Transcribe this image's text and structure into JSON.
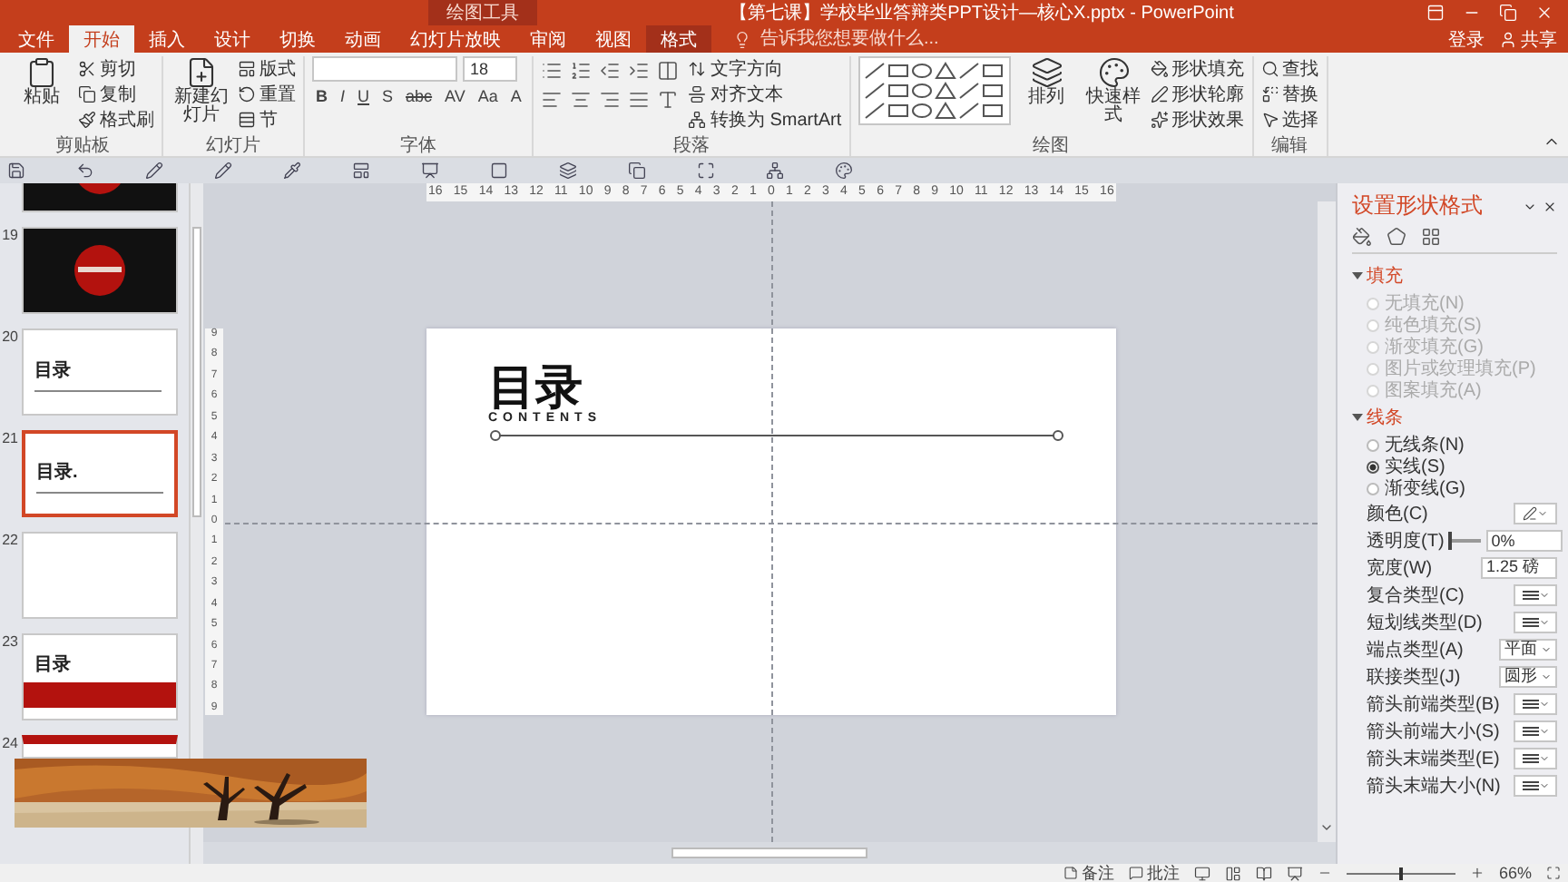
{
  "title_bar": {
    "context_group": "绘图工具",
    "title": "【第七课】学校毕业答辩类PPT设计—核心X.pptx - PowerPoint"
  },
  "tabs": [
    {
      "label": "文件",
      "selected": false,
      "contextual": false
    },
    {
      "label": "开始",
      "selected": true,
      "contextual": false
    },
    {
      "label": "插入",
      "selected": false,
      "contextual": false
    },
    {
      "label": "设计",
      "selected": false,
      "contextual": false
    },
    {
      "label": "切换",
      "selected": false,
      "contextual": false
    },
    {
      "label": "动画",
      "selected": false,
      "contextual": false
    },
    {
      "label": "幻灯片放映",
      "selected": false,
      "contextual": false
    },
    {
      "label": "审阅",
      "selected": false,
      "contextual": false
    },
    {
      "label": "视图",
      "selected": false,
      "contextual": false
    },
    {
      "label": "格式",
      "selected": false,
      "contextual": true
    }
  ],
  "tell_me": {
    "placeholder": "告诉我您想要做什么..."
  },
  "account": {
    "sign_in": "登录",
    "share": "共享"
  },
  "ribbon_groups": [
    {
      "kind": "clipboard",
      "label": "剪贴板",
      "large_buttons": [
        "粘贴"
      ],
      "small_buttons": [
        "剪切",
        "复制",
        "格式刷"
      ]
    },
    {
      "kind": "slides",
      "label": "幻灯片",
      "large_buttons": [
        "新建幻灯片"
      ],
      "small_buttons": [
        "版式",
        "重置",
        "节"
      ]
    },
    {
      "kind": "font",
      "label": "字体",
      "font_size": "18",
      "format_buttons": [
        "B",
        "I",
        "U",
        "S",
        "abc",
        "AV",
        "Aa",
        "A"
      ]
    },
    {
      "kind": "paragraph",
      "label": "段落",
      "small_buttons": [
        "文字方向",
        "对齐文本",
        "转换为 SmartArt"
      ]
    },
    {
      "kind": "drawing",
      "label": "绘图",
      "large_buttons": [
        "排列",
        "快速样式"
      ],
      "small_buttons": [
        "形状填充",
        "形状轮廓",
        "形状效果"
      ]
    },
    {
      "kind": "editing",
      "label": "编辑",
      "small_buttons": [
        "查找",
        "替换",
        "选择"
      ]
    }
  ],
  "thumbnails": [
    {
      "kind": "dark",
      "selected": false
    },
    {
      "number": "19",
      "kind": "dark",
      "selected": false
    },
    {
      "number": "20",
      "kind": "contents",
      "title": "目录",
      "selected": false
    },
    {
      "number": "21",
      "kind": "contents",
      "title": "目录.",
      "selected": true
    },
    {
      "number": "22",
      "kind": "blank",
      "selected": false
    },
    {
      "number": "23",
      "kind": "red_band",
      "title": "目录",
      "selected": false
    },
    {
      "number": "24",
      "kind": "red_top",
      "selected": false
    }
  ],
  "rulers": {
    "horizontal": [
      "16",
      "15",
      "14",
      "13",
      "12",
      "11",
      "10",
      "9",
      "8",
      "7",
      "6",
      "5",
      "4",
      "3",
      "2",
      "1",
      "0",
      "1",
      "2",
      "3",
      "4",
      "5",
      "6",
      "7",
      "8",
      "9",
      "10",
      "11",
      "12",
      "13",
      "14",
      "15",
      "16"
    ],
    "vertical": [
      "9",
      "8",
      "7",
      "6",
      "5",
      "4",
      "3",
      "2",
      "1",
      "0",
      "1",
      "2",
      "3",
      "4",
      "5",
      "6",
      "7",
      "8",
      "9"
    ]
  },
  "slide": {
    "title": "目录",
    "subtitle": "CONTENTS"
  },
  "format_pane": {
    "title": "设置形状格式",
    "sections": [
      {
        "label": "填充",
        "expanded": true,
        "options": [
          {
            "label": "无填充(N)",
            "selected": false,
            "disabled": true
          },
          {
            "label": "纯色填充(S)",
            "selected": false,
            "disabled": true
          },
          {
            "label": "渐变填充(G)",
            "selected": false,
            "disabled": true
          },
          {
            "label": "图片或纹理填充(P)",
            "selected": false,
            "disabled": true
          },
          {
            "label": "图案填充(A)",
            "selected": false,
            "disabled": true
          }
        ]
      },
      {
        "label": "线条",
        "expanded": true,
        "options": [
          {
            "label": "无线条(N)",
            "selected": false,
            "disabled": false
          },
          {
            "label": "实线(S)",
            "selected": true,
            "disabled": false
          },
          {
            "label": "渐变线(G)",
            "selected": false,
            "disabled": false
          }
        ]
      }
    ],
    "properties": [
      {
        "kind": "color",
        "label": "颜色(C)"
      },
      {
        "kind": "slider",
        "label": "透明度(T)",
        "level": 0,
        "value": "0%"
      },
      {
        "kind": "spinner",
        "label": "宽度(W)",
        "value": "1.25 磅"
      },
      {
        "kind": "icon_dropdown",
        "label": "复合类型(C)"
      },
      {
        "kind": "icon_dropdown",
        "label": "短划线类型(D)"
      },
      {
        "kind": "dropdown",
        "label": "端点类型(A)",
        "value": "平面"
      },
      {
        "kind": "dropdown",
        "label": "联接类型(J)",
        "value": "圆形"
      },
      {
        "kind": "icon_dropdown",
        "label": "箭头前端类型(B)"
      },
      {
        "kind": "icon_dropdown",
        "label": "箭头前端大小(S)"
      },
      {
        "kind": "icon_dropdown",
        "label": "箭头末端类型(E)"
      },
      {
        "kind": "icon_dropdown",
        "label": "箭头末端大小(N)"
      }
    ]
  },
  "status_bar": {
    "notes": "备注",
    "comments": "批注",
    "zoom": {
      "level": 0.5,
      "value": "66%"
    }
  }
}
